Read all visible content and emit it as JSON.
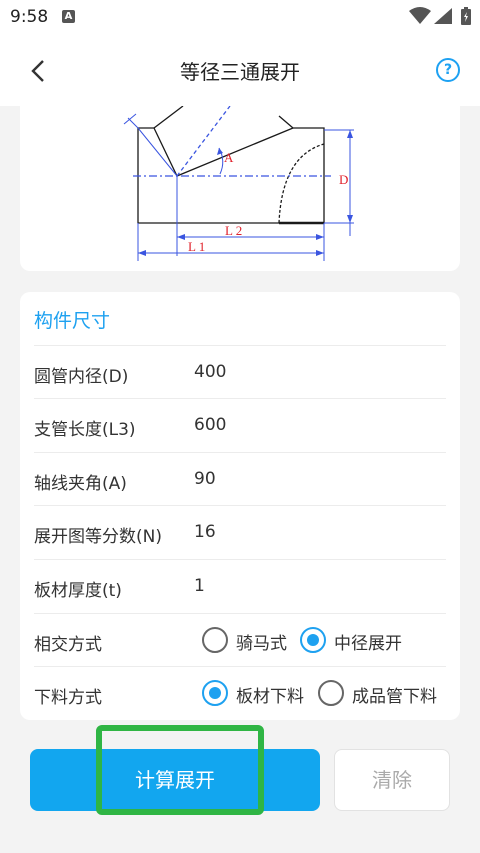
{
  "status_bar": {
    "time": "9:58",
    "notification_letter": "A"
  },
  "app_bar": {
    "title": "等径三通展开",
    "help_symbol": "?"
  },
  "diagram": {
    "label_a": "A",
    "label_d": "D",
    "label_l1": "L 1",
    "label_l2": "L 2"
  },
  "form": {
    "section_title": "构件尺寸",
    "fields": [
      {
        "label": "圆管内径(D)",
        "value": "400"
      },
      {
        "label": "支管长度(L3)",
        "value": "600"
      },
      {
        "label": "轴线夹角(A)",
        "value": "90"
      },
      {
        "label": "展开图等分数(N)",
        "value": "16"
      },
      {
        "label": "板材厚度(t)",
        "value": "1"
      }
    ],
    "intersection": {
      "label": "相交方式",
      "options": [
        "骑马式",
        "中径展开"
      ],
      "selected": "中径展开"
    },
    "cutting": {
      "label": "下料方式",
      "options": [
        "板材下料",
        "成品管下料"
      ],
      "selected": "板材下料"
    }
  },
  "buttons": {
    "calculate": "计算展开",
    "clear": "清除"
  }
}
